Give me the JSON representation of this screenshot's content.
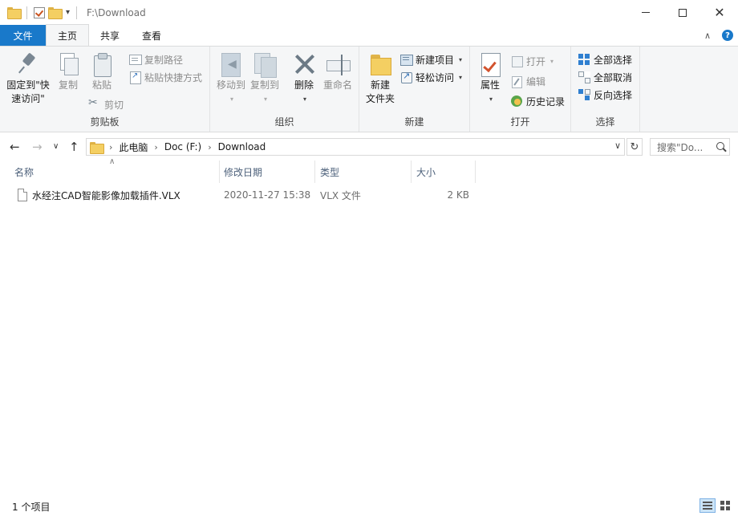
{
  "window": {
    "title": "F:\\Download",
    "minimize": "—",
    "maximize": "☐",
    "close": "✕"
  },
  "tabs": {
    "file": "文件",
    "home": "主页",
    "share": "共享",
    "view": "查看"
  },
  "ribbon": {
    "clipboard": {
      "label": "剪贴板",
      "pin": "固定到\"快\n速访问\"",
      "pin_line1": "固定到\"快",
      "pin_line2": "速访问\"",
      "copy": "复制",
      "paste": "粘贴",
      "copy_path": "复制路径",
      "paste_shortcut": "粘贴快捷方式",
      "cut": "剪切"
    },
    "organize": {
      "label": "组织",
      "move_to": "移动到",
      "copy_to": "复制到",
      "delete": "删除",
      "rename": "重命名"
    },
    "new": {
      "label": "新建",
      "new_folder_line1": "新建",
      "new_folder_line2": "文件夹",
      "new_item": "新建项目",
      "easy_access": "轻松访问"
    },
    "open": {
      "label": "打开",
      "properties": "属性",
      "open": "打开",
      "edit": "编辑",
      "history": "历史记录"
    },
    "select": {
      "label": "选择",
      "select_all": "全部选择",
      "select_none": "全部取消",
      "invert": "反向选择"
    }
  },
  "address": {
    "crumbs": [
      "此电脑",
      "Doc (F:)",
      "Download"
    ],
    "search_placeholder": "搜索\"Do..."
  },
  "columns": {
    "name": "名称",
    "date": "修改日期",
    "type": "类型",
    "size": "大小"
  },
  "files": [
    {
      "name": "水经注CAD智能影像加载插件.VLX",
      "date": "2020-11-27 15:38",
      "type": "VLX 文件",
      "size": "2 KB"
    }
  ],
  "status": {
    "count": "1 个项目"
  }
}
